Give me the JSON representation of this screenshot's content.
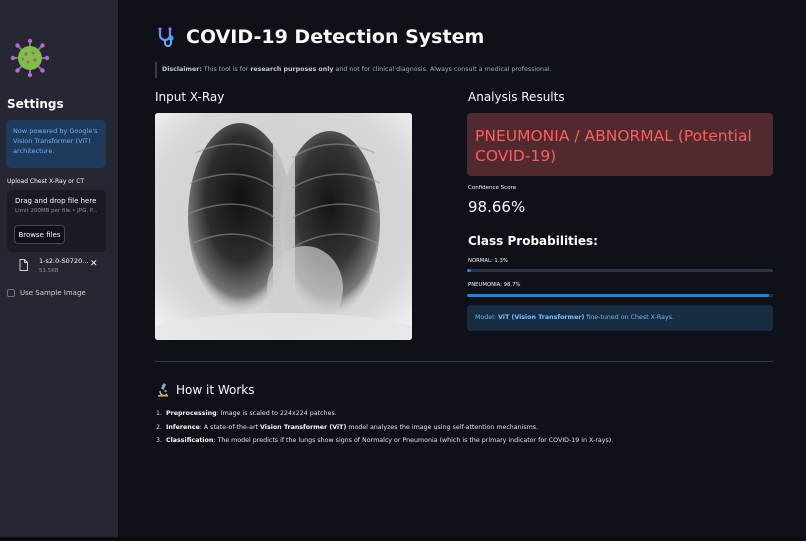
{
  "sidebar": {
    "logo_icon": "virus-icon",
    "title": "Settings",
    "info_text": "Now powered by Google's Vision Transformer (ViT) architecture.",
    "upload_label": "Upload Chest X-Ray or CT",
    "dropzone_title": "Drag and drop file here",
    "dropzone_sub": "Limit 200MB per file • JPG, P...",
    "browse_label": "Browse files",
    "file_name": "1-s2.0-S0720...",
    "file_size": "51.5KB",
    "close_glyph": "✕",
    "sample_label": "Use Sample Image"
  },
  "header": {
    "icon": "stethoscope-icon",
    "title": "COVID-19 Detection System"
  },
  "disclaimer": {
    "label": "Disclaimer:",
    "text_pre": " This tool is for ",
    "bold": "research purposes only",
    "text_post": " and not for clinical diagnosis. Always consult a medical professional."
  },
  "input_section": {
    "heading": "Input X-Ray"
  },
  "results": {
    "heading": "Analysis Results",
    "diagnosis": "PNEUMONIA / ABNORMAL (Potential COVID-19)",
    "confidence_label": "Confidence Score",
    "confidence_value": "98.66%",
    "probs_heading": "Class Probabilities:",
    "probs": [
      {
        "label": "NORMAL: 1.3%",
        "value": 0.013
      },
      {
        "label": "PNEUMONIA: 98.7%",
        "value": 0.987
      }
    ],
    "model_pre": "Model: ",
    "model_bold": "ViT (Vision Transformer)",
    "model_post": " fine-tuned on Chest X-Rays."
  },
  "how": {
    "icon": "microscope-icon",
    "title": "How it Works",
    "steps": [
      {
        "num": "1.",
        "bold": "Preprocessing",
        "text": ": Image is scaled to 224x224 patches."
      },
      {
        "num": "2.",
        "bold": "Inference",
        "text_pre": ": A state-of-the-art ",
        "bold2": "Vision Transformer (ViT)",
        "text": " model analyzes the image using self-attention mechanisms."
      },
      {
        "num": "3.",
        "bold": "Classification",
        "text": ": The model predicts if the lungs show signs of Normalcy or Pneumonia (which is the primary indicator for COVID-19 in X-rays)."
      }
    ]
  },
  "colors": {
    "accent": "#1c83e1",
    "danger": "#ff5c5c",
    "sidebar_bg": "#262730",
    "main_bg": "#0e1117"
  }
}
